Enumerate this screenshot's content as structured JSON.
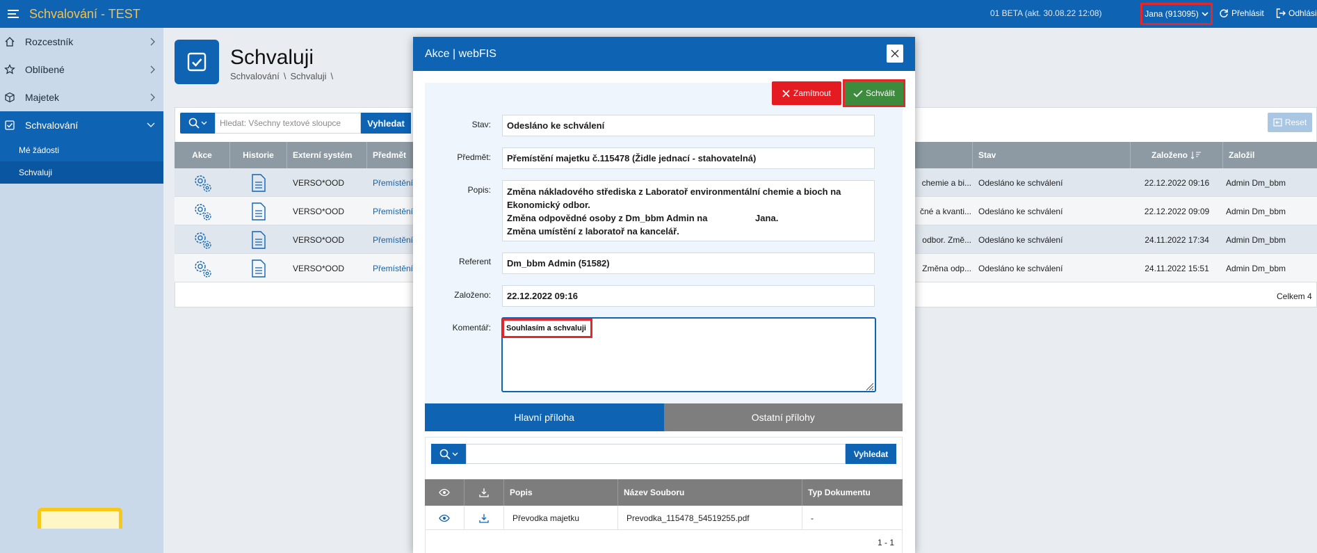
{
  "app": {
    "title": "Schvalování - TEST",
    "version": "01 BETA (akt. 30.08.22 12:08)",
    "user": "Jana (913095)",
    "relogin": "Přehlásit",
    "logout": "Odhlási"
  },
  "sidebar": {
    "items": [
      {
        "label": "Rozcestník",
        "icon": "home-icon"
      },
      {
        "label": "Oblíbené",
        "icon": "star-icon"
      },
      {
        "label": "Majetek",
        "icon": "cube-icon"
      },
      {
        "label": "Schvalování",
        "icon": "checkbox-icon"
      }
    ],
    "subitems": [
      "Mé žádosti",
      "Schvaluji"
    ]
  },
  "page": {
    "title": "Schvaluji",
    "breadcrumb": [
      "Schvalování",
      "Schvaluji"
    ]
  },
  "search": {
    "placeholder": "Hledat: Všechny textové sloupce",
    "button": "Vyhledat",
    "reset": "Reset"
  },
  "grid": {
    "columns": [
      "Akce",
      "Historie",
      "Externí systém",
      "Předmět",
      "Stav",
      "Založeno",
      "Založil"
    ],
    "rows": [
      {
        "system": "VERSO*OOD",
        "predmet": "Přemístění",
        "popis": "chemie a bi...",
        "stav": "Odesláno ke schválení",
        "zalozeno": "22.12.2022 09:16",
        "zalozil": "Admin Dm_bbm"
      },
      {
        "system": "VERSO*OOD",
        "predmet": "Přemístění",
        "popis": "čné a kvanti...",
        "stav": "Odesláno ke schválení",
        "zalozeno": "22.12.2022 09:09",
        "zalozil": "Admin Dm_bbm"
      },
      {
        "system": "VERSO*OOD",
        "predmet": "Přemístění",
        "popis": "odbor. Změ...",
        "stav": "Odesláno ke schválení",
        "zalozeno": "24.11.2022 17:34",
        "zalozil": "Admin Dm_bbm"
      },
      {
        "system": "VERSO*OOD",
        "predmet": "Přemístění",
        "popis": "Změna odp...",
        "stav": "Odesláno ke schválení",
        "zalozeno": "24.11.2022 15:51",
        "zalozil": "Admin Dm_bbm"
      }
    ],
    "total": "Celkem 4"
  },
  "modal": {
    "title": "Akce | webFIS",
    "reject": "Zamítnout",
    "approve": "Schválit",
    "fields": {
      "stav": {
        "label": "Stav:",
        "value": "Odesláno ke schválení"
      },
      "predmet": {
        "label": "Předmět:",
        "value": "Přemístění majetku č.115478 (Židle jednací - stahovatelná)"
      },
      "popis": {
        "label": "Popis:",
        "lines": [
          "Změna nákladového střediska z Laboratoř environmentální chemie a bioch na",
          "Ekonomický odbor.",
          "Změna odpovědné osoby z Dm_bbm Admin na                   Jana.",
          "Změna umístění z laboratoř na kancelář."
        ]
      },
      "referent": {
        "label": "Referent",
        "value": "Dm_bbm Admin (51582)"
      },
      "zalozeno": {
        "label": "Založeno:",
        "value": "22.12.2022 09:16"
      },
      "komentar": {
        "label": "Komentář:",
        "value": "Souhlasím a schvaluji"
      }
    },
    "tabs": [
      "Hlavní příloha",
      "Ostatní přílohy"
    ],
    "attachments": {
      "search_button": "Vyhledat",
      "columns": [
        "Popis",
        "Název Souboru",
        "Typ Dokumentu"
      ],
      "rows": [
        {
          "popis": "Převodka majetku",
          "soubor": "Prevodka_115478_54519255.pdf",
          "typ": "-"
        }
      ],
      "pager": "1 - 1"
    }
  }
}
